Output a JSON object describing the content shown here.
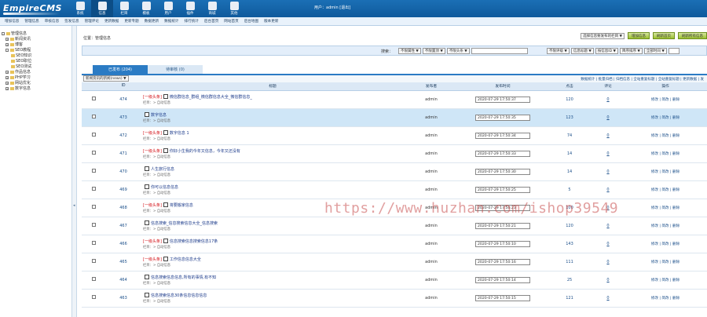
{
  "brand": {
    "logo": "EmpireCMS"
  },
  "topnav": [
    {
      "label": "系统",
      "icon": "system-icon"
    },
    {
      "label": "信息",
      "icon": "info-icon"
    },
    {
      "label": "栏目",
      "icon": "column-icon"
    },
    {
      "label": "模板",
      "icon": "template-icon"
    },
    {
      "label": "用户",
      "icon": "user-icon"
    },
    {
      "label": "插件",
      "icon": "plugin-icon"
    },
    {
      "label": "商城",
      "icon": "shop-icon"
    },
    {
      "label": "其他",
      "icon": "other-icon"
    }
  ],
  "user_info": "用户：admin [退出]",
  "subnav": [
    "增加信息",
    "管理信息",
    "审核信息",
    "签发信息",
    "管理评论",
    "更新数据",
    "更新专题",
    "数据更新",
    "数据统计",
    "排行统计",
    "后台首页",
    "网站首页",
    "后台地图",
    "版本更新"
  ],
  "sidebar": {
    "items": [
      {
        "label": "管理信息",
        "level": 0,
        "marker": "-"
      },
      {
        "label": "新闻资讯",
        "level": 1,
        "marker": "+"
      },
      {
        "label": "博客",
        "level": 1,
        "marker": "+"
      },
      {
        "label": "SEO教程",
        "level": 1,
        "marker": "-"
      },
      {
        "label": "SEO知识",
        "level": 2,
        "marker": ""
      },
      {
        "label": "SEO职位",
        "level": 2,
        "marker": ""
      },
      {
        "label": "SEO测试",
        "level": 2,
        "marker": ""
      },
      {
        "label": "作品信息",
        "level": 1,
        "marker": "+"
      },
      {
        "label": "PHP学习",
        "level": 1,
        "marker": "+"
      },
      {
        "label": "网站优化",
        "level": 1,
        "marker": "+"
      },
      {
        "label": "数字信息",
        "level": 1,
        "marker": "+"
      }
    ]
  },
  "main": {
    "location": "位置：管理信息",
    "top_select": "选择信息要发布的栏目 ▼",
    "top_buttons": [
      "增加信息",
      "刷新首页",
      "刷新所有信息"
    ],
    "search": {
      "label": "搜索：",
      "selects_left": [
        "不限属性 ▼",
        "不限置顶 ▼",
        "不限头条 ▼"
      ],
      "selects_right": [
        "不限评级 ▼",
        "信息标题 ▼",
        "按信息ID ▼",
        "降序排序 ▼",
        "全部时间 ▼"
      ]
    },
    "tabs": [
      {
        "label": "已发布 (204)",
        "active": true
      },
      {
        "label": "待审核 (0)",
        "active": false
      }
    ],
    "batch_select": "新闻资讯的新闻(news) ▼",
    "tool_links": "数据统计 | 批量归档 | 归档信息 | 全站重复标题 | 全站重复标题 | 更新数据 | 发"
  },
  "table": {
    "headers": [
      "",
      "ID",
      "标题",
      "发布者",
      "发布时间",
      "点击",
      "评论",
      "操作"
    ],
    "ops": "修改 | 简改 | 删除",
    "rows": [
      {
        "id": "474",
        "tag": "[一级头条]",
        "title": "微信群信息_群组_微信群信息大全_微信群信息_",
        "col": "栏目：> 自动信息",
        "user": "admin",
        "time": "2020-07-29 17:50:37",
        "hits": "120",
        "comments": "0",
        "hl": false
      },
      {
        "id": "473",
        "tag": "",
        "title": "数字信息",
        "col": "栏目：> 自动信息",
        "user": "admin",
        "time": "2020-07-29 17:50:35",
        "hits": "123",
        "comments": "0",
        "hl": true
      },
      {
        "id": "472",
        "tag": "[一级头条]",
        "title": "数字信息 1",
        "col": "栏目：> 自动信息",
        "user": "admin",
        "time": "2020-07-29 17:50:34",
        "hits": "74",
        "comments": "0",
        "hl": false
      },
      {
        "id": "471",
        "tag": "[一级头条]",
        "title": "你好小生我的今年又信息，今年又还没有",
        "col": "栏目：> 自动信息",
        "user": "admin",
        "time": "2020-07-29 17:50:33",
        "hits": "14",
        "comments": "0",
        "hl": false
      },
      {
        "id": "470",
        "tag": "",
        "title": "人生旅行信息",
        "col": "栏目：> 自动信息",
        "user": "admin",
        "time": "2020-07-29 17:50:30",
        "hits": "14",
        "comments": "0",
        "hl": false
      },
      {
        "id": "469",
        "tag": "",
        "title": "你可以信息信息",
        "col": "栏目：> 自动信息",
        "user": "admin",
        "time": "2020-07-29 17:50:25",
        "hits": "5",
        "comments": "0",
        "hl": false
      },
      {
        "id": "468",
        "tag": "[一级头条]",
        "title": "将要搬家信息",
        "col": "栏目：> 自动信息",
        "user": "admin",
        "time": "2020-07-29 17:50:23",
        "hits": "100",
        "comments": "0",
        "hl": false
      },
      {
        "id": "467",
        "tag": "",
        "title": "信息搜索_信息搜索信息大全_信息搜索",
        "col": "栏目：> 自动信息",
        "user": "admin",
        "time": "2020-07-29 17:50:21",
        "hits": "120",
        "comments": "0",
        "hl": false
      },
      {
        "id": "466",
        "tag": "[一级头条]",
        "title": "信息搜索信息搜索信息17条",
        "col": "栏目：> 自动信息",
        "user": "admin",
        "time": "2020-07-29 17:50:10",
        "hits": "143",
        "comments": "0",
        "hl": false
      },
      {
        "id": "465",
        "tag": "[一级头条]",
        "title": "工作信息信息大全",
        "col": "栏目：> 自动信息",
        "user": "admin",
        "time": "2020-07-29 17:50:16",
        "hits": "111",
        "comments": "0",
        "hl": false
      },
      {
        "id": "464",
        "tag": "",
        "title": "信息搜索信息信息,所有的事情,有不知",
        "col": "栏目：> 自动信息",
        "user": "admin",
        "time": "2020-07-29 17:50:14",
        "hits": "25",
        "comments": "0",
        "hl": false
      },
      {
        "id": "463",
        "tag": "",
        "title": "信息搜索信息30条信息信息信息",
        "col": "栏目：> 自动信息",
        "user": "admin",
        "time": "2020-07-29 17:50:15",
        "hits": "121",
        "comments": "0",
        "hl": false
      }
    ]
  },
  "watermark": "https://www.huzhan.com/ishop39549"
}
